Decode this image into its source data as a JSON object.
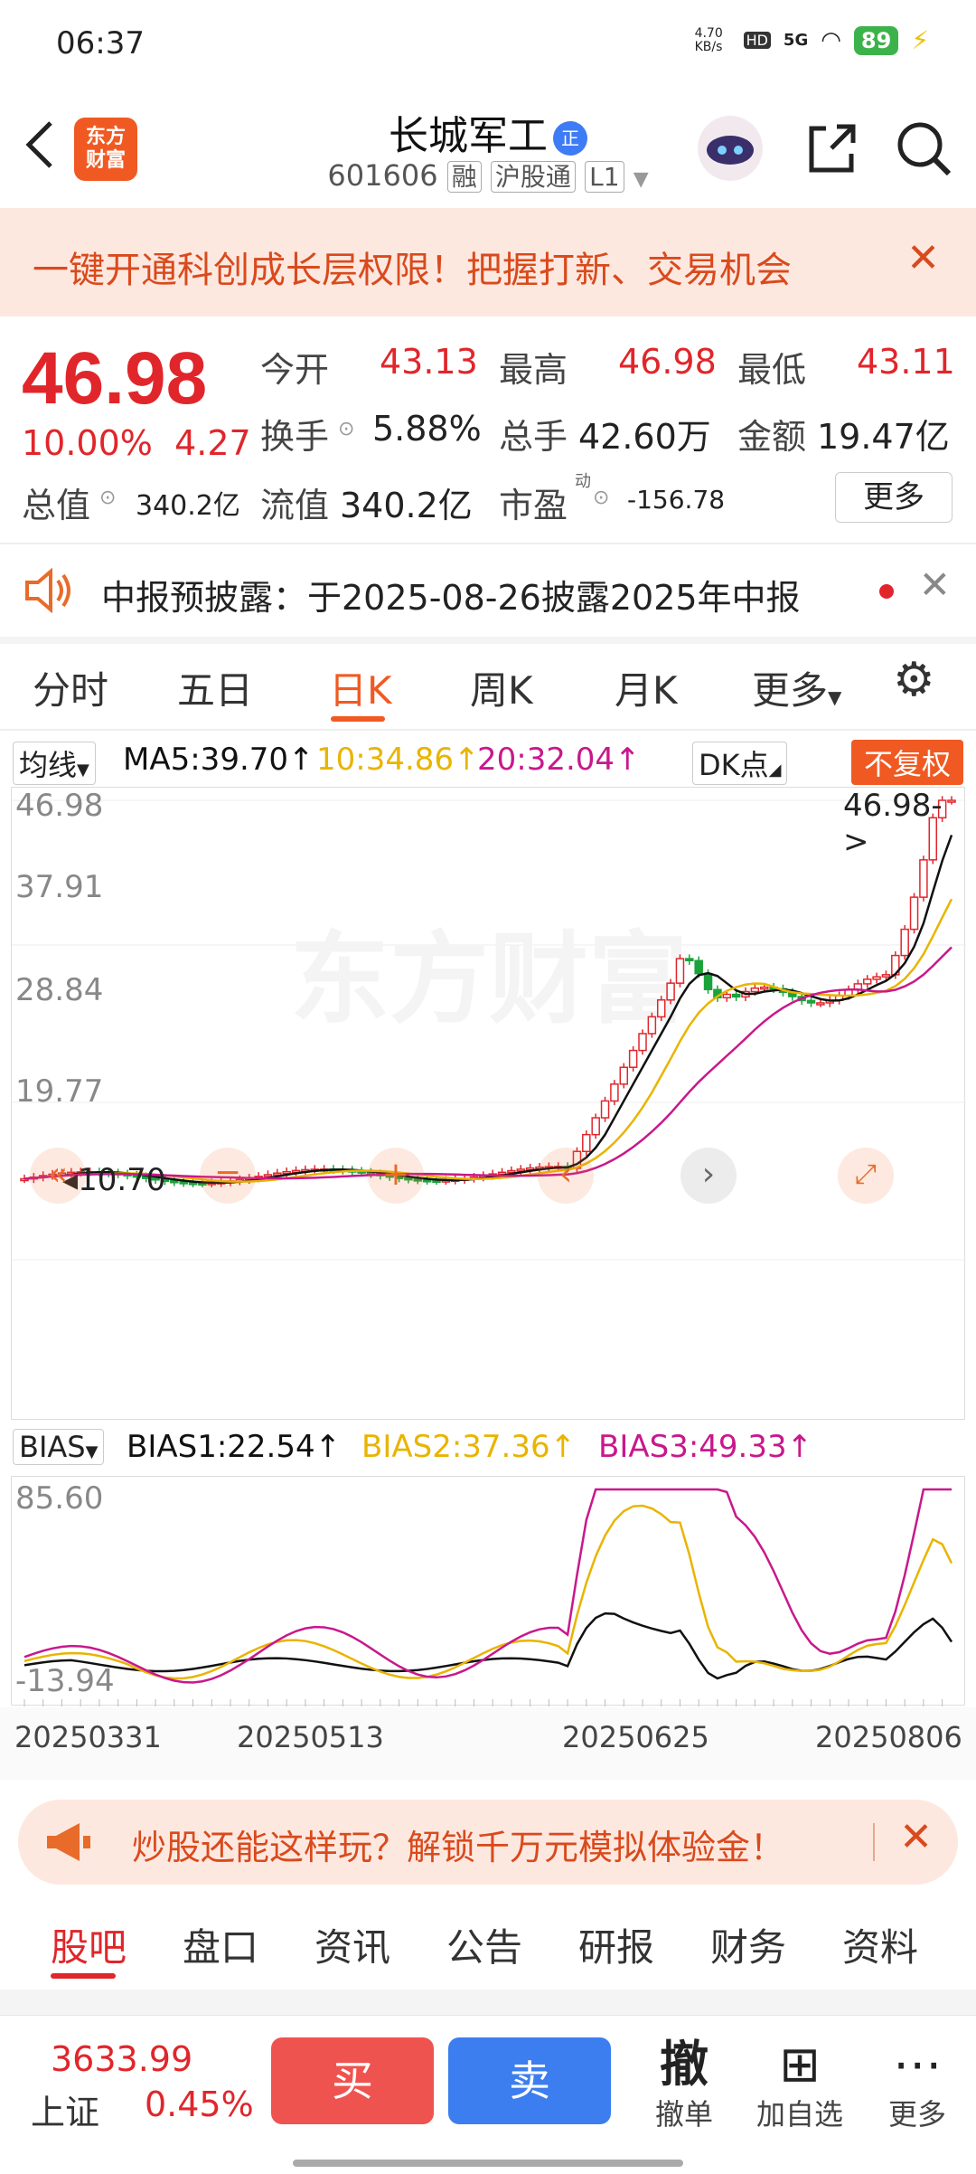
{
  "status": {
    "time": "06:37",
    "net_speed": "4.70 KB/s",
    "network": "5G",
    "battery": "89"
  },
  "header": {
    "logo_line1": "东方",
    "logo_line2": "财富",
    "title": "长城军工",
    "title_badge": "正",
    "code": "601606",
    "tag1": "融",
    "tag2": "沪股通",
    "tag3": "L1"
  },
  "banner": {
    "text": "一键开通科创成长层权限！把握打新、交易机会",
    "close": "✕"
  },
  "quote": {
    "price": "46.98",
    "change_pct": "10.00%",
    "change": "4.27",
    "open_label": "今开",
    "open": "43.13",
    "high_label": "最高",
    "high": "46.98",
    "low_label": "最低",
    "low": "43.11",
    "turnover_label": "换手",
    "turnover": "5.88%",
    "volume_label": "总手",
    "volume": "42.60万",
    "amount_label": "金额",
    "amount": "19.47亿",
    "mcap_label": "总值",
    "mcap": "340.2亿",
    "float_label": "流值",
    "float": "340.2亿",
    "pe_label": "市盈",
    "pe_sup": "动",
    "pe": "-156.78",
    "more": "更多"
  },
  "notice": {
    "text": "中报预披露：于2025-08-26披露2025年中报",
    "close": "✕"
  },
  "tabs": [
    "分时",
    "五日",
    "日K",
    "周K",
    "月K",
    "更多",
    "⚙"
  ],
  "active_tab": "日K",
  "ma": {
    "selector": "均线",
    "ma5": "MA5:39.70",
    "ma10": "10:34.86",
    "ma20": "20:32.04",
    "dk": "DK点",
    "fq": "不复权"
  },
  "kline": {
    "y_labels": [
      "46.98",
      "37.91",
      "28.84",
      "19.77",
      "10.70"
    ],
    "last_label": "46.98->",
    "low_label": "10.70",
    "watermark": "东方财富",
    "colors": {
      "up": "#e0262b",
      "down": "#1aa33a",
      "ma5": "#111111",
      "ma10": "#e9b400",
      "ma20": "#c8188c"
    }
  },
  "bias": {
    "selector": "BIAS",
    "b1": "BIAS1:22.54",
    "b2": "BIAS2:37.36",
    "b3": "BIAS3:49.33",
    "top": "85.60",
    "bottom": "-13.94"
  },
  "dates": [
    "20250331",
    "20250513",
    "20250625",
    "20250806"
  ],
  "promo": {
    "text": "炒股还能这样玩？解锁千万元模拟体验金！",
    "close": "✕"
  },
  "bottom_tabs": [
    "股吧",
    "盘口",
    "资讯",
    "公告",
    "研报",
    "财务",
    "资料"
  ],
  "bottom": {
    "index_value": "3633.99",
    "index_name": "上证",
    "index_change": "0.45%",
    "buy": "买",
    "sell": "卖",
    "cancel_icon": "撤",
    "cancel": "撤单",
    "add": "加自选",
    "more": "更多"
  },
  "chart_data": {
    "type": "line",
    "title": "",
    "x": [
      "20250331",
      "20250513",
      "20250625",
      "20250806"
    ],
    "ylim": [
      10.7,
      46.98
    ],
    "series": [
      {
        "name": "MA5",
        "last": 39.7
      },
      {
        "name": "MA10",
        "last": 34.86
      },
      {
        "name": "MA20",
        "last": 32.04
      }
    ]
  }
}
